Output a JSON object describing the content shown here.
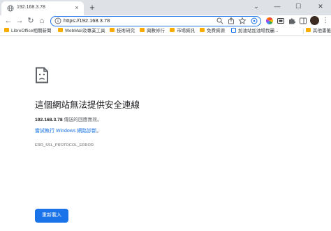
{
  "tab": {
    "title": "192.168.3.78",
    "close_glyph": "×",
    "new_tab_glyph": "+",
    "favicon": "globe-icon"
  },
  "window_controls": {
    "menu_glyph": "⌄",
    "minimize_glyph": "—",
    "maximize_glyph": "☐",
    "close_glyph": "✕"
  },
  "toolbar": {
    "back_glyph": "←",
    "forward_glyph": "→",
    "reload_glyph": "↻",
    "home_glyph": "⌂",
    "url": "https://192.168.3.78",
    "omnibox_icons": [
      "zoom-icon",
      "share-icon",
      "star-icon",
      "extension-icon"
    ],
    "extensions": [
      "color-picker-icon",
      "screenshot-icon",
      "puzzle-icon",
      "sidebar-icon"
    ],
    "menu_glyph": "⋮"
  },
  "bookmarks": {
    "items": [
      {
        "label": "LibreOffice相關新聞",
        "icon": "folder-icon"
      },
      {
        "label": "WebMail及專業工具",
        "icon": "folder-icon"
      },
      {
        "label": "技術研究",
        "icon": "folder-icon"
      },
      {
        "label": "興數修行",
        "icon": "folder-icon"
      },
      {
        "label": "市場資訊",
        "icon": "folder-icon"
      },
      {
        "label": "免費資源",
        "icon": "folder-icon"
      },
      {
        "label": "加油站加油場找麗...",
        "icon": "page-icon"
      }
    ],
    "other_label": "其他書籤"
  },
  "error": {
    "icon": "sad-page-icon",
    "title": "這個網站無法提供安全連線",
    "host": "192.168.3.78",
    "detail_suffix": " 傳送的回應無效。",
    "link_text": "嘗試執行 Windows 網路診斷",
    "link_suffix": "。",
    "code": "ERR_SSL_PROTOCOL_ERROR",
    "reload_label": "重新載入"
  },
  "colors": {
    "accent": "#1a73e8",
    "tabstrip": "#dee1e6",
    "folder": "#f9ab00"
  }
}
